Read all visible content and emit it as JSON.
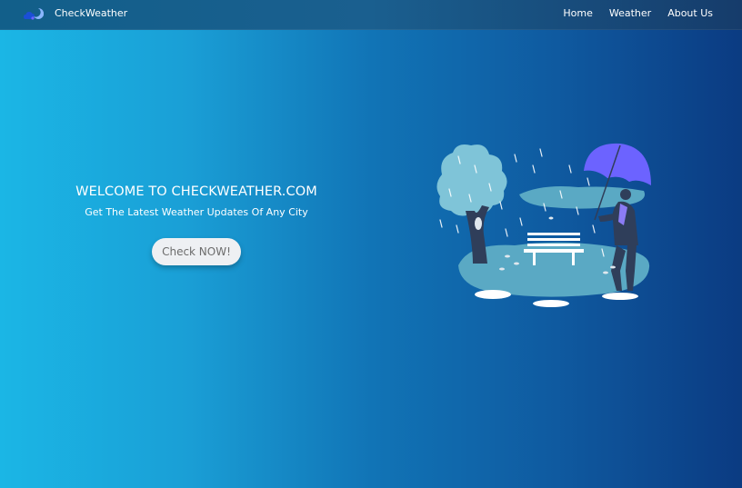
{
  "nav": {
    "logo_icon": "cloud-moon-icon",
    "brand": "CheckWeather",
    "links": [
      "Home",
      "Weather",
      "About Us"
    ]
  },
  "hero": {
    "title": "WELCOME TO CHECKWEATHER.COM",
    "subtitle": "Get The Latest Weather Updates Of Any City",
    "cta": "Check NOW!"
  },
  "illustration": "rainy-park-woman-umbrella-illustration",
  "colors": {
    "bg_left": "#1bb6e5",
    "bg_right": "#0b3b82",
    "accent_purple": "#6c63ff",
    "button_bg": "#eef0f3"
  }
}
